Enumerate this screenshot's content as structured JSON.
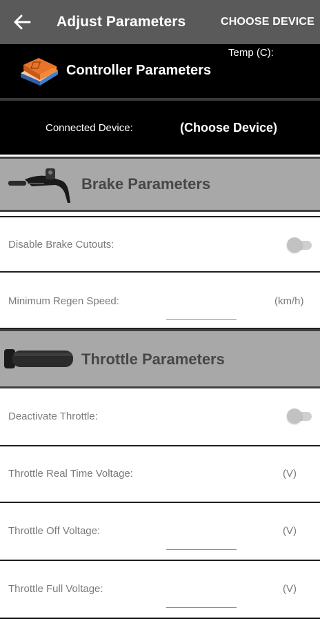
{
  "app_bar": {
    "title": "Adjust Parameters",
    "action_label": "CHOOSE DEVICE",
    "back_icon": "arrow-left-icon"
  },
  "controller": {
    "title": "Controller Parameters",
    "temp_label": "Temp (C):",
    "icon": "controller-box-icon"
  },
  "connection": {
    "label": "Connected Device:",
    "value": "(Choose Device)"
  },
  "brake": {
    "title": "Brake Parameters",
    "icon": "brake-lever-icon",
    "disable_cutouts_label": "Disable Brake Cutouts:",
    "disable_cutouts_on": false,
    "min_regen_label": "Minimum Regen Speed:",
    "min_regen_unit": "(km/h)",
    "min_regen_value": ""
  },
  "throttle": {
    "title": "Throttle Parameters",
    "icon": "throttle-grip-icon",
    "deactivate_label": "Deactivate Throttle:",
    "deactivate_on": false,
    "realtime_label": "Throttle Real Time Voltage:",
    "realtime_unit": "(V)",
    "off_label": "Throttle Off Voltage:",
    "off_unit": "(V)",
    "off_value": "",
    "full_label": "Throttle Full Voltage:",
    "full_unit": "(V)",
    "full_value": ""
  },
  "colors": {
    "app_bar": "#5a5a5a",
    "panel": "#000000",
    "section_header": "#a8a8a8",
    "label_text": "#7a7a7a",
    "controller_icon_orange": "#e8742a",
    "controller_icon_blue": "#3f7fd0"
  }
}
